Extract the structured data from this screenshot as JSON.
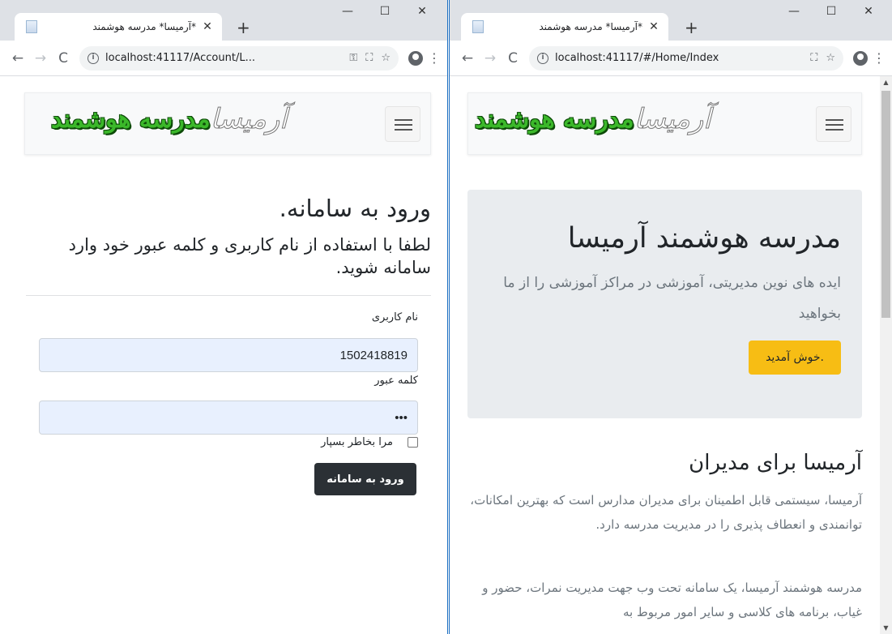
{
  "left": {
    "tab_title": "*آرمیسا* مدرسه هوشمند",
    "url": "localhost:41117/Account/L...",
    "logo_text": "مدرسه هوشمند",
    "logo_brand": "آرمیسا",
    "heading": "ورود به سامانه.",
    "subheading": "لطفا با استفاده از نام کاربری و کلمه عبور خود وارد سامانه شوید.",
    "username_label": "نام کاربری",
    "username_value": "1502418819",
    "password_label": "کلمه عبور",
    "password_value": "•••",
    "remember_label": "مرا بخاطر بسپار",
    "login_button": "ورود به سامانه"
  },
  "right": {
    "tab_title": "*آرمیسا* مدرسه هوشمند",
    "url": "localhost:41117/#/Home/Index",
    "logo_text": "مدرسه هوشمند",
    "logo_brand": "آرمیسا",
    "jumbo_title": "مدرسه هوشمند آرمیسا",
    "jumbo_lead": "ایده های نوین مدیریتی، آموزشی در مراکز آموزشی را از ما بخواهید",
    "welcome_button": "خوش آمدید.",
    "section_heading": "آرمیسا برای مدیران",
    "paragraph1": "آرمیسا، سیستمی قابل اطمینان برای مدیران مدارس است که بهترین امکانات، توانمندی و انعطاف پذیری را در مدیریت مدرسه دارد.",
    "paragraph2": "مدرسه هوشمند آرمیسا، یک سامانه تحت وب جهت مدیریت نمرات، حضور و غیاب، برنامه های کلاسی و سایر امور مربوط به"
  },
  "colors": {
    "login_button": "#2b3035",
    "welcome_button": "#f7bd14",
    "logo_green": "#3bb82a",
    "field_autofill": "#e8f0fe"
  }
}
